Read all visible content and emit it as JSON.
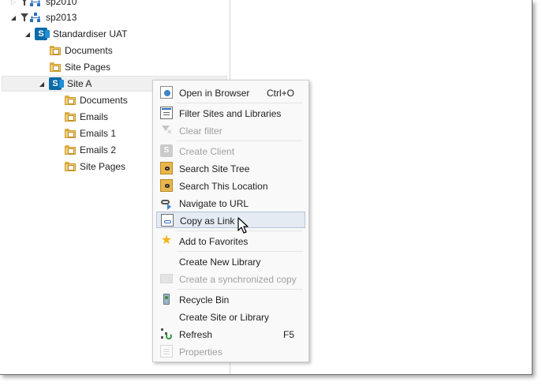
{
  "tree": {
    "nodes": [
      {
        "label": "sp2010",
        "icon": "filter-network-icon"
      },
      {
        "label": "sp2013",
        "icon": "filter-network-icon"
      },
      {
        "label": "Standardiser UAT",
        "icon": "sharepoint-icon"
      },
      {
        "label": "Documents",
        "icon": "folder-icon"
      },
      {
        "label": "Site Pages",
        "icon": "folder-icon"
      },
      {
        "label": "Site A",
        "icon": "sharepoint-icon",
        "selected": true
      },
      {
        "label": "Documents",
        "icon": "folder-icon"
      },
      {
        "label": "Emails",
        "icon": "folder-icon"
      },
      {
        "label": "Emails 1",
        "icon": "folder-icon"
      },
      {
        "label": "Emails 2",
        "icon": "folder-icon"
      },
      {
        "label": "Site Pages",
        "icon": "folder-icon"
      }
    ]
  },
  "context_menu": {
    "items": [
      {
        "label": "Open in Browser",
        "shortcut": "Ctrl+O",
        "icon": "globe-document-icon",
        "enabled": true
      },
      {
        "label": "Filter Sites and Libraries",
        "icon": "filter-sites-icon",
        "enabled": true
      },
      {
        "label": "Clear filter",
        "icon": "clear-filter-icon",
        "enabled": false
      },
      {
        "label": "Create Client",
        "icon": "sharepoint-icon",
        "enabled": false
      },
      {
        "label": "Search Site Tree",
        "icon": "search-tree-icon",
        "enabled": true
      },
      {
        "label": "Search This Location",
        "icon": "search-location-icon",
        "enabled": true
      },
      {
        "label": "Navigate to URL",
        "icon": "link-arrow-icon",
        "enabled": true
      },
      {
        "label": "Copy as Link",
        "icon": "copy-link-icon",
        "enabled": true,
        "hover": true
      },
      {
        "label": "Add to Favorites",
        "icon": "star-icon",
        "enabled": true
      },
      {
        "label": "Create New Library",
        "enabled": true
      },
      {
        "label": "Create a synchronized copy",
        "icon": "sync-copy-icon",
        "enabled": false
      },
      {
        "label": "Recycle Bin",
        "icon": "recycle-bin-icon",
        "enabled": true
      },
      {
        "label": "Create Site or Library",
        "enabled": true
      },
      {
        "label": "Refresh",
        "shortcut": "F5",
        "icon": "refresh-icon",
        "enabled": true
      },
      {
        "label": "Properties",
        "icon": "properties-icon",
        "enabled": false
      }
    ]
  },
  "colors": {
    "hover_bg": "#e5ebf3",
    "hover_border": "#b5c3d8",
    "disabled_text": "#a0a0a0",
    "sharepoint_blue": "#0b6aa8",
    "folder_yellow": "#f4cf73"
  }
}
